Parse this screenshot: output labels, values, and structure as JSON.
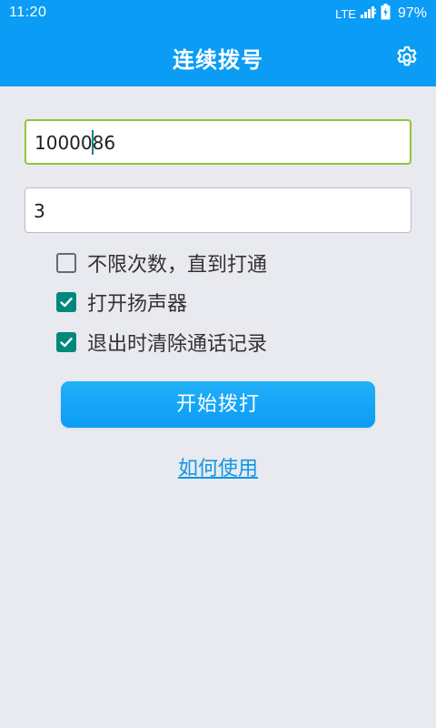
{
  "status_bar": {
    "time": "11:20",
    "network": "LTE",
    "battery": "97%",
    "icons": [
      "signal-icon",
      "battery-icon"
    ]
  },
  "app_bar": {
    "title": "连续拨号",
    "settings_icon": "gear-icon",
    "background_color": "#0b9cf5"
  },
  "form": {
    "phone_number": "1000086",
    "call_count": "3"
  },
  "options": [
    {
      "label": "不限次数，直到打通",
      "checked": false
    },
    {
      "label": "打开扬声器",
      "checked": true
    },
    {
      "label": "退出时清除通话记录",
      "checked": true
    }
  ],
  "actions": {
    "start_label": "开始拨打",
    "howto_label": "如何使用"
  },
  "colors": {
    "accent": "#0b9cf5",
    "checkbox_on": "#00897b",
    "focus_border": "#8dc63f",
    "link": "#1296e6",
    "page_background": "#e8eaef"
  }
}
